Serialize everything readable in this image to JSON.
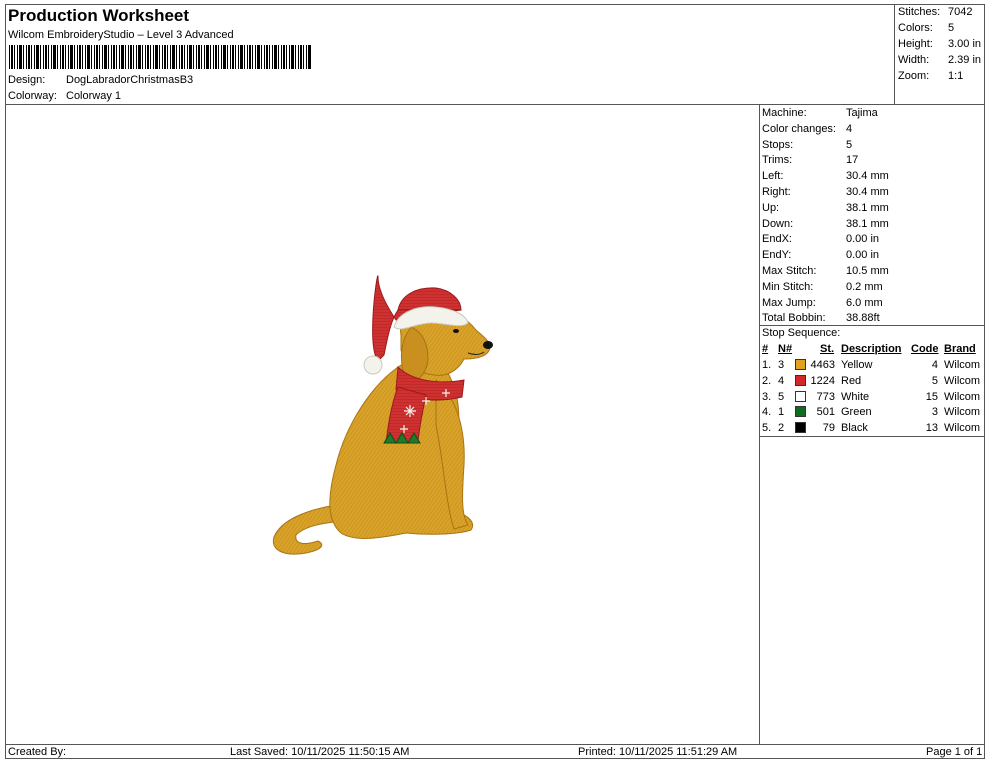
{
  "header": {
    "title": "Production Worksheet",
    "software": "Wilcom EmbroideryStudio – Level 3 Advanced",
    "design_label": "Design:",
    "design_value": "DogLabradorChristmasB3",
    "colorway_label": "Colorway:",
    "colorway_value": "Colorway 1"
  },
  "summary": {
    "stitches_label": "Stitches:",
    "stitches": "7042",
    "colors_label": "Colors:",
    "colors": "5",
    "height_label": "Height:",
    "height": "3.00 in",
    "width_label": "Width:",
    "width": "2.39 in",
    "zoom_label": "Zoom:",
    "zoom": "1:1"
  },
  "machine_stats": [
    {
      "label": "Machine:",
      "value": "Tajima"
    },
    {
      "label": "Color changes:",
      "value": "4"
    },
    {
      "label": "Stops:",
      "value": "5"
    },
    {
      "label": "Trims:",
      "value": "17"
    },
    {
      "label": "Left:",
      "value": "30.4 mm"
    },
    {
      "label": "Right:",
      "value": "30.4 mm"
    },
    {
      "label": "Up:",
      "value": "38.1 mm"
    },
    {
      "label": "Down:",
      "value": "38.1 mm"
    },
    {
      "label": "EndX:",
      "value": "0.00 in"
    },
    {
      "label": "EndY:",
      "value": "0.00 in"
    },
    {
      "label": "Max Stitch:",
      "value": "10.5 mm"
    },
    {
      "label": "Min Stitch:",
      "value": "0.2 mm"
    },
    {
      "label": "Max Jump:",
      "value": "6.0 mm"
    },
    {
      "label": "Total Bobbin:",
      "value": "38.88ft"
    }
  ],
  "stop_sequence": {
    "title": "Stop Sequence:",
    "headers": {
      "num": "#",
      "n": "N#",
      "st": "St.",
      "description": "Description",
      "code": "Code",
      "brand": "Brand"
    },
    "rows": [
      {
        "num": "1.",
        "n": "3",
        "st": "4463",
        "description": "Yellow",
        "code": "4",
        "brand": "Wilcom",
        "color": "#e0a21f"
      },
      {
        "num": "2.",
        "n": "4",
        "st": "1224",
        "description": "Red",
        "code": "5",
        "brand": "Wilcom",
        "color": "#d0282b"
      },
      {
        "num": "3.",
        "n": "5",
        "st": "773",
        "description": "White",
        "code": "15",
        "brand": "Wilcom",
        "color": "#ffffff"
      },
      {
        "num": "4.",
        "n": "1",
        "st": "501",
        "description": "Green",
        "code": "3",
        "brand": "Wilcom",
        "color": "#0f6b1e"
      },
      {
        "num": "5.",
        "n": "2",
        "st": "79",
        "description": "Black",
        "code": "13",
        "brand": "Wilcom",
        "color": "#000000"
      }
    ]
  },
  "footer": {
    "created_by": "Created By:",
    "last_saved": "Last Saved: 10/11/2025 11:50:15 AM",
    "printed": "Printed: 10/11/2025 11:51:29 AM",
    "page": "Page 1 of 1"
  },
  "colors": {
    "fur": "#d9a229",
    "fur_dark": "#a87412",
    "scarf": "#cf3130",
    "hat_trim": "#f4f4ee",
    "green": "#1f7a2a"
  }
}
